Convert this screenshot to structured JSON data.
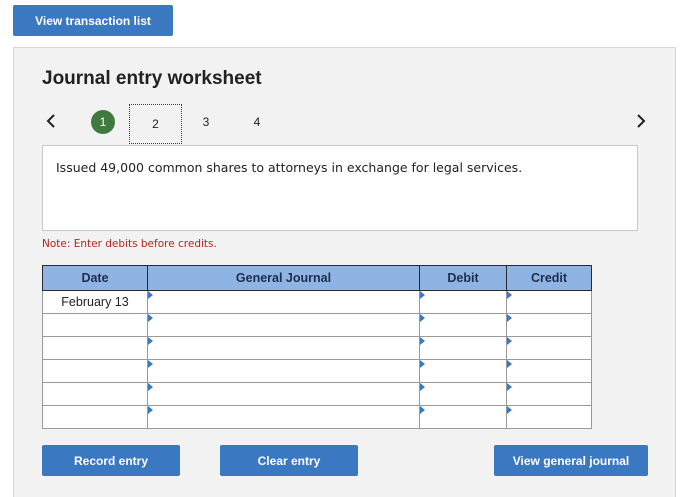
{
  "header": {
    "view_transactions_label": "View transaction list"
  },
  "worksheet": {
    "title": "Journal entry worksheet",
    "steps": [
      "1",
      "2",
      "3",
      "4"
    ],
    "description": "Issued 49,000 common shares to attorneys in exchange for legal services.",
    "note": "Note: Enter debits before credits."
  },
  "table": {
    "columns": [
      "Date",
      "General Journal",
      "Debit",
      "Credit"
    ],
    "rows": [
      {
        "date": "February 13"
      },
      {
        "date": ""
      },
      {
        "date": ""
      },
      {
        "date": ""
      },
      {
        "date": ""
      },
      {
        "date": ""
      }
    ]
  },
  "actions": {
    "record_label": "Record entry",
    "clear_label": "Clear entry",
    "view_general_journal_label": "View general journal"
  }
}
